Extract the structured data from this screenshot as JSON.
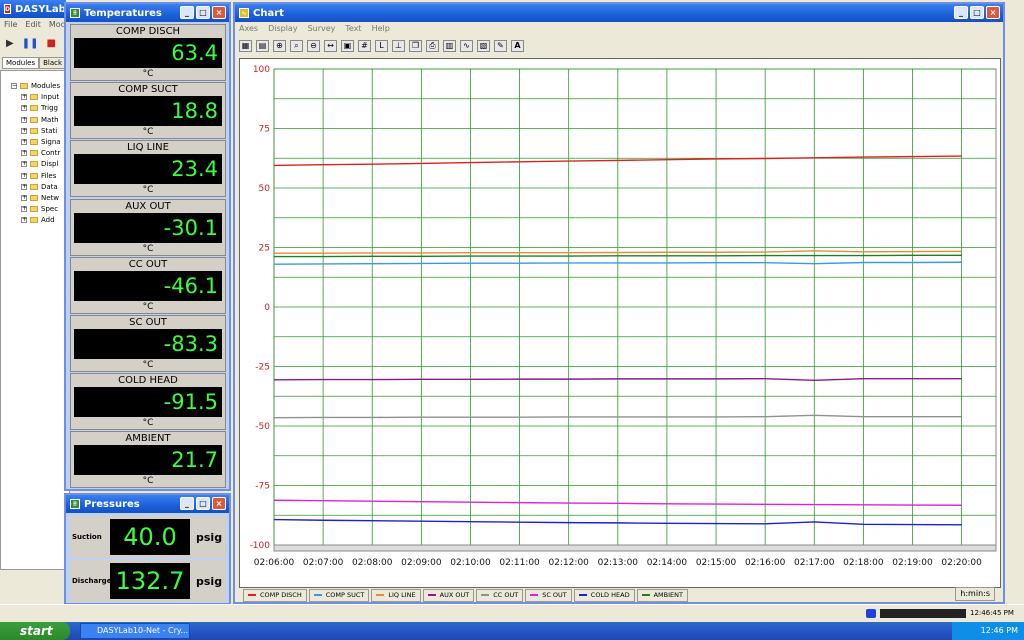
{
  "app": {
    "title": "DASYLab10",
    "menu": [
      "File",
      "Edit",
      "Modul"
    ]
  },
  "sidebar": {
    "tabs": [
      "Modules",
      "Black B"
    ],
    "items": [
      "Modules",
      "Input",
      "Trigg",
      "Math",
      "Stati",
      "Signa",
      "Contr",
      "Displ",
      "Files",
      "Data",
      "Netw",
      "Spec",
      "Add"
    ]
  },
  "temperatures": {
    "title": "Temperatures",
    "unit": "°C",
    "meters": [
      {
        "label": "COMP DISCH",
        "value": "63.4"
      },
      {
        "label": "COMP SUCT",
        "value": "18.8"
      },
      {
        "label": "LIQ LINE",
        "value": "23.4"
      },
      {
        "label": "AUX OUT",
        "value": "-30.1"
      },
      {
        "label": "CC OUT",
        "value": "-46.1"
      },
      {
        "label": "SC OUT",
        "value": "-83.3"
      },
      {
        "label": "COLD HEAD",
        "value": "-91.5"
      },
      {
        "label": "AMBIENT",
        "value": "21.7"
      }
    ]
  },
  "pressures": {
    "title": "Pressures",
    "rows": [
      {
        "label": "Suction",
        "value": "40.0",
        "unit": "psig"
      },
      {
        "label": "Discharge",
        "value": "132.7",
        "unit": "psig"
      }
    ]
  },
  "chart_window": {
    "title": "Chart",
    "menu": [
      "Axes",
      "Display",
      "Survey",
      "Text",
      "Help"
    ],
    "time_unit": "h:min:s"
  },
  "chart_data": {
    "type": "line",
    "ylim": [
      -100,
      100
    ],
    "yticks": [
      100,
      75,
      50,
      25,
      0,
      -25,
      -50,
      -75,
      -100
    ],
    "x": [
      "02:06:00",
      "02:07:00",
      "02:08:00",
      "02:09:00",
      "02:10:00",
      "02:11:00",
      "02:12:00",
      "02:13:00",
      "02:14:00",
      "02:15:00",
      "02:16:00",
      "02:17:00",
      "02:18:00",
      "02:19:00",
      "02:20:00"
    ],
    "xlabel": "h:min:s",
    "series": [
      {
        "name": "COMP DISCH",
        "color": "#e02020",
        "values": [
          59.5,
          59.8,
          60.0,
          60.3,
          60.7,
          61.0,
          61.3,
          61.6,
          61.9,
          62.2,
          62.4,
          62.7,
          63.0,
          63.2,
          63.4
        ]
      },
      {
        "name": "COMP SUCT",
        "color": "#3a9ae0",
        "values": [
          18.0,
          18.1,
          18.2,
          18.3,
          18.4,
          18.4,
          18.5,
          18.5,
          18.5,
          18.6,
          18.6,
          18.2,
          18.7,
          18.7,
          18.8
        ]
      },
      {
        "name": "LIQ LINE",
        "color": "#e09030",
        "values": [
          22.6,
          22.6,
          22.7,
          22.7,
          22.8,
          22.8,
          22.8,
          22.9,
          23.0,
          23.0,
          23.1,
          23.6,
          23.2,
          23.3,
          23.4
        ]
      },
      {
        "name": "AUX OUT",
        "color": "#8a1a8a",
        "values": [
          -30.6,
          -30.5,
          -30.5,
          -30.4,
          -30.4,
          -30.3,
          -30.3,
          -30.2,
          -30.2,
          -30.2,
          -30.1,
          -30.8,
          -30.1,
          -30.1,
          -30.1
        ]
      },
      {
        "name": "CC OUT",
        "color": "#909090",
        "values": [
          -46.5,
          -46.4,
          -46.4,
          -46.3,
          -46.3,
          -46.3,
          -46.2,
          -46.2,
          -46.2,
          -46.2,
          -46.1,
          -45.5,
          -46.1,
          -46.1,
          -46.1
        ]
      },
      {
        "name": "SC OUT",
        "color": "#e020e0",
        "values": [
          -81.2,
          -81.4,
          -81.6,
          -81.8,
          -82.0,
          -82.2,
          -82.4,
          -82.5,
          -82.7,
          -82.8,
          -82.9,
          -83.0,
          -83.1,
          -83.2,
          -83.3
        ]
      },
      {
        "name": "COLD HEAD",
        "color": "#2020d0",
        "values": [
          -89.3,
          -89.6,
          -89.8,
          -90.0,
          -90.2,
          -90.4,
          -90.6,
          -90.7,
          -90.9,
          -91.0,
          -91.1,
          -90.3,
          -91.3,
          -91.4,
          -91.5
        ]
      },
      {
        "name": "AMBIENT",
        "color": "#208020",
        "values": [
          21.2,
          21.2,
          21.3,
          21.3,
          21.4,
          21.4,
          21.4,
          21.5,
          21.5,
          21.5,
          21.6,
          21.6,
          21.6,
          21.7,
          21.7
        ]
      }
    ]
  },
  "statusbar": {
    "time": "12:46:45 PM"
  },
  "taskbar": {
    "start": "start",
    "task": "DASYLab10-Net - Cry...",
    "clock": "12:46 PM"
  }
}
